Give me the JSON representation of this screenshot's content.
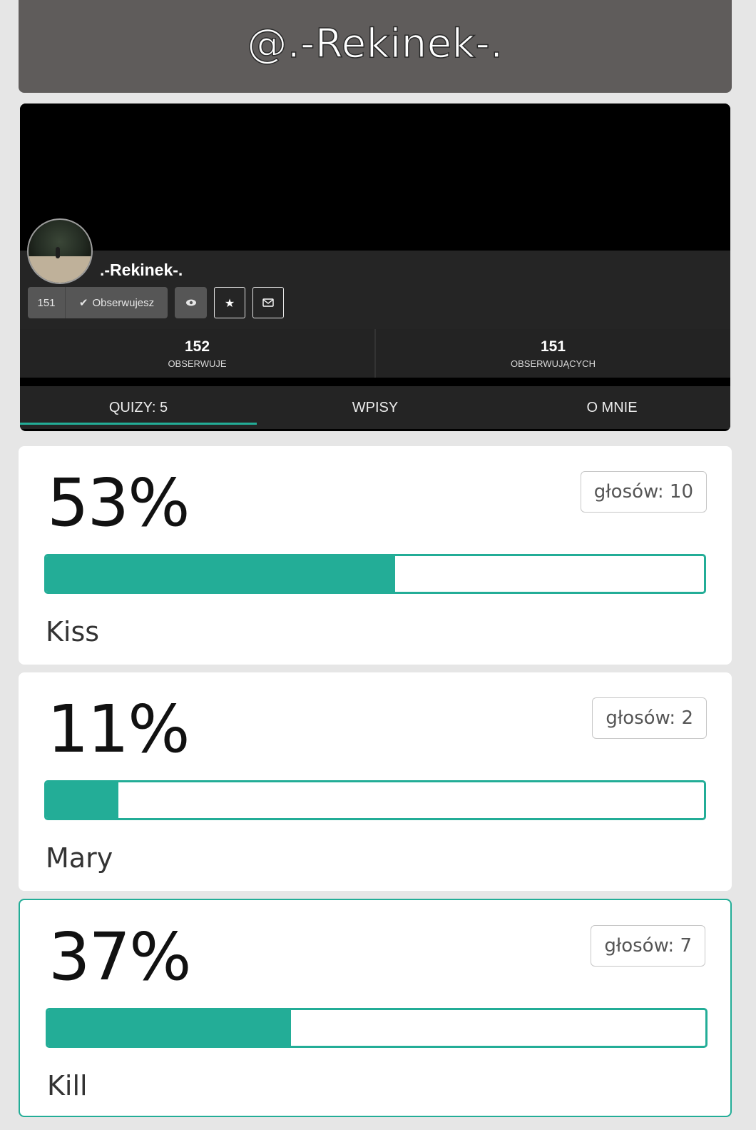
{
  "header": {
    "title": "@.-Rekinek-."
  },
  "profile": {
    "username": ".-Rekinek-.",
    "follower_count_badge": "151",
    "follow_button_label": "Obserwujesz",
    "icons": [
      "eye-icon",
      "star-icon",
      "envelope-icon"
    ],
    "stats": [
      {
        "value": "152",
        "label": "OBSERWUJE"
      },
      {
        "value": "151",
        "label": "OBSERWUJĄCYCH"
      }
    ],
    "tabs": [
      {
        "label": "QUIZY: 5",
        "active": true
      },
      {
        "label": "WPISY",
        "active": false
      },
      {
        "label": "O MNIE",
        "active": false
      }
    ]
  },
  "poll": {
    "accent_color": "#23ad97",
    "options": [
      {
        "percent_label": "53%",
        "percent": 53,
        "votes_label": "głosów: 10",
        "option": "Kiss",
        "selected": false
      },
      {
        "percent_label": "11%",
        "percent": 11,
        "votes_label": "głosów: 2",
        "option": "Mary",
        "selected": false
      },
      {
        "percent_label": "37%",
        "percent": 37,
        "votes_label": "głosów: 7",
        "option": "Kill",
        "selected": true
      }
    ]
  }
}
